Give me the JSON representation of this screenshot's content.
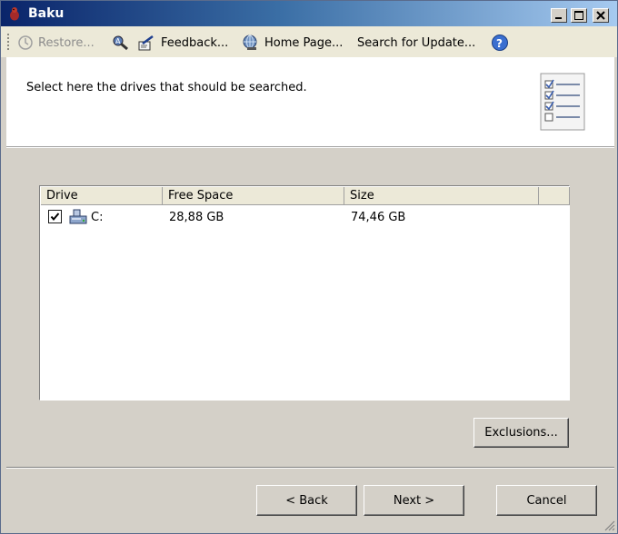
{
  "window": {
    "title": "Baku"
  },
  "toolbar": {
    "restore": "Restore...",
    "feedback": "Feedback...",
    "home_page": "Home Page...",
    "search_update": "Search for Update..."
  },
  "header": {
    "text": "Select here the drives that should be searched."
  },
  "drives_table": {
    "columns": [
      "Drive",
      "Free Space",
      "Size"
    ],
    "rows": [
      {
        "checked": true,
        "drive": "C:",
        "free_space": "28,88 GB",
        "size": "74,46 GB"
      }
    ]
  },
  "buttons": {
    "exclusions": "Exclusions...",
    "back": "< Back",
    "next": "Next >",
    "cancel": "Cancel"
  }
}
